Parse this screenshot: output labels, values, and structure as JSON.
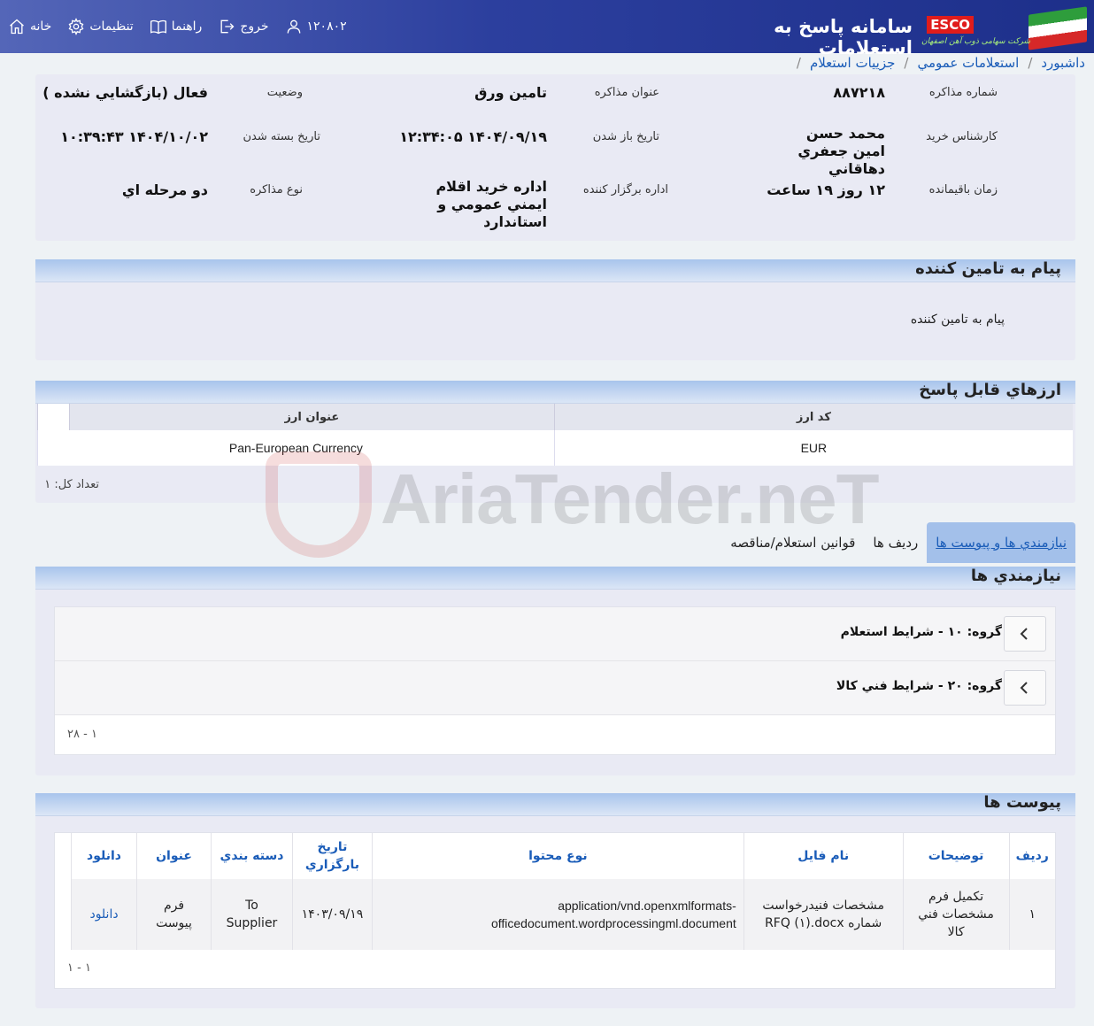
{
  "header": {
    "title": "سامانه پاسخ به استعلامات",
    "logo_text": "ESCO",
    "company": "شرکت سهامی ذوب آهن اصفهان",
    "nav": [
      {
        "label": "خانه",
        "icon": "home-icon"
      },
      {
        "label": "تنظيمات",
        "icon": "gear-icon"
      },
      {
        "label": "راهنما",
        "icon": "book-icon"
      },
      {
        "label": "خروج",
        "icon": "logout-icon"
      },
      {
        "label": "۱۲۰۸۰۲",
        "icon": "user-icon"
      }
    ]
  },
  "breadcrumb": [
    "داشبورد",
    "استعلامات عمومي",
    "جزييات استعلام"
  ],
  "info": {
    "inquiry_number_label": "شماره مذاکره",
    "inquiry_number": "۸۸۷۲۱۸",
    "title_label": "عنوان مذاکره",
    "title": "تامين ورق",
    "status_label": "وضعيت",
    "status": "فعال (بازگشايي نشده )",
    "buyer_label": "کارشناس خريد",
    "buyer": "محمد حسن امين جعفري دهاقاني",
    "open_date_label": "تاريخ باز شدن",
    "open_date": "۱۴۰۴/۰۹/۱۹ ۱۲:۳۴:۰۵",
    "close_date_label": "تاريخ بسته شدن",
    "close_date": "۱۴۰۴/۱۰/۰۲ ۱۰:۳۹:۴۳",
    "remaining_label": "زمان باقيمانده",
    "remaining": "۱۲ روز ۱۹ ساعت",
    "organizer_label": "اداره برگزار کننده",
    "organizer": "اداره خريد اقلام ايمني عمومي و استاندارد",
    "type_label": "نوع مذاکره",
    "type": "دو مرحله اي"
  },
  "message": {
    "title": "پيام به تامين کننده",
    "body": "پيام به تامين کننده"
  },
  "currencies": {
    "title": "ارزهاي قابل پاسخ",
    "columns": [
      "کد ارز",
      "عنوان ارز"
    ],
    "rows": [
      {
        "code": "EUR",
        "name": "Pan-European Currency"
      }
    ],
    "count_text": "تعداد کل: ۱"
  },
  "tabs": [
    "نيازمندي ها و پيوست ها",
    "رديف ها",
    "قوانين استعلام/مناقصه"
  ],
  "requirements": {
    "title": "نيازمندي ها",
    "groups": [
      "گروه: ۱۰ - شرايط استعلام",
      "گروه: ۲۰ - شرايط فني کالا"
    ],
    "pager": "۱ - ۲۸"
  },
  "attachments": {
    "title": "پيوست ها",
    "columns": [
      "رديف",
      "توضيحات",
      "نام فايل",
      "نوع محتوا",
      "تاريخ بارگزاري",
      "دسته بندي",
      "عنوان",
      "دانلود"
    ],
    "rows": [
      {
        "row": "۱",
        "description": "تکميل فرم مشخصات فني کالا",
        "file_name": "مشخصات فنيدرخواست شماره RFQ (۱).docx",
        "content_type": "application/vnd.openxmlformats-officedocument.wordprocessingml.document",
        "upload_date": "۱۴۰۳/۰۹/۱۹",
        "category": "To Supplier",
        "title": "فرم پيوست",
        "download": "دانلود"
      }
    ],
    "pager": "۱ - ۱"
  },
  "watermark": "AriaTender.neT"
}
